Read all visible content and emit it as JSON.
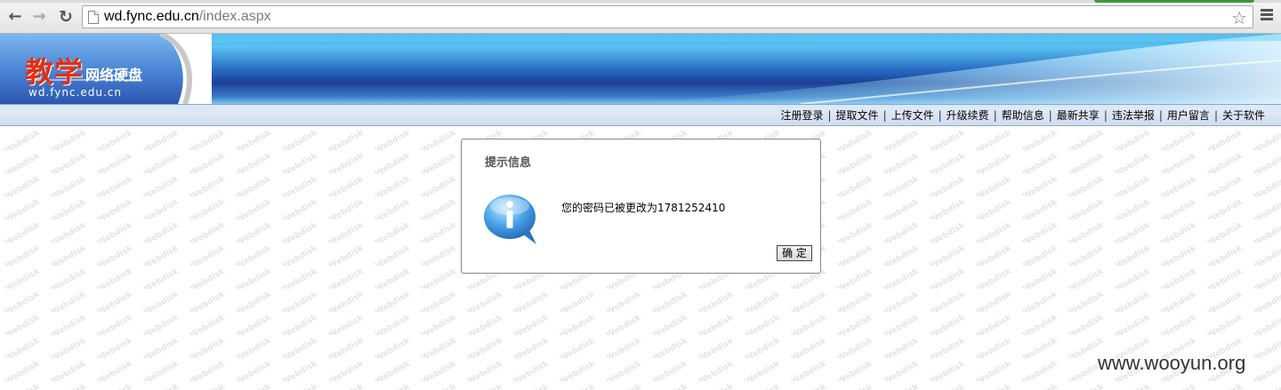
{
  "browser": {
    "url_host": "wd.fync.edu.cn",
    "url_path": "/index.aspx",
    "back_icon": "arrow-left-icon",
    "forward_icon": "arrow-right-icon",
    "reload_icon": "reload-icon",
    "star_icon": "star-icon",
    "menu_icon": "hamburger-menu-icon"
  },
  "header": {
    "logo_main": "教学",
    "logo_sub": "网络硬盘",
    "logo_url": "wd.fync.edu.cn"
  },
  "nav": {
    "items": [
      {
        "label": "注册登录"
      },
      {
        "label": "提取文件"
      },
      {
        "label": "上传文件"
      },
      {
        "label": "升级续费"
      },
      {
        "label": "帮助信息"
      },
      {
        "label": "最新共享"
      },
      {
        "label": "违法举报"
      },
      {
        "label": "用户留言"
      },
      {
        "label": "关于软件"
      }
    ],
    "separator": "|"
  },
  "dialog": {
    "title": "提示信息",
    "message": "您的密码已被更改为1781252410",
    "ok_label": "确 定",
    "icon": "info-icon"
  },
  "watermark": {
    "text": "Webdisk",
    "footer": "www.wooyun.org"
  },
  "colors": {
    "logo_red": "#e62e0e",
    "header_blue": "#2a6fc6",
    "dialog_border": "#888888"
  }
}
